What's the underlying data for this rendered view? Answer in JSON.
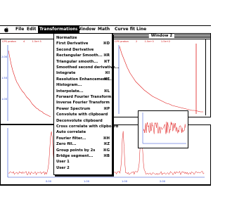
{
  "menubar": {
    "items": [
      "File",
      "Edit",
      "Transformations",
      "Window",
      "Math",
      "Curve fit",
      "Line"
    ]
  },
  "windows": {
    "left": {
      "header": [
        "CPS proton",
        "4",
        "1.5e+3"
      ]
    },
    "right": {
      "title": "Window 2",
      "header": [
        "CPS proton",
        "2",
        "1.5e+3",
        "1.5e+2"
      ]
    }
  },
  "transform_menu": {
    "items": [
      {
        "label": "Normalize",
        "key": ""
      },
      {
        "label": "First Derivative",
        "key": "⌘D"
      },
      {
        "label": "Second Derivative",
        "key": ""
      },
      {
        "label": "Rectangular Smooth...",
        "key": "⌘R"
      },
      {
        "label": "Triangular smooth...",
        "key": "⌘T"
      },
      {
        "label": "Smoothed second derivative...",
        "key": ""
      },
      {
        "label": "Integrate",
        "key": "⌘I"
      },
      {
        "label": "Resolution Enhancement...",
        "key": "⌘E"
      },
      {
        "label": "Histogram...",
        "key": ""
      },
      {
        "label": "Interpolate...",
        "key": "⌘L"
      },
      {
        "label": "Forward Fourier Transform",
        "key": ""
      },
      {
        "label": "Inverse Fourier Transform",
        "key": ""
      },
      {
        "label": "Power Spectrum",
        "key": "⌘P"
      },
      {
        "label": "Convolute with clipboard",
        "key": ""
      },
      {
        "label": "Deconvolute clipboard",
        "key": ""
      },
      {
        "label": "Cross correlate with clipboard",
        "key": ""
      },
      {
        "label": "Auto correlate",
        "key": ""
      },
      {
        "label": "Fourier filter...",
        "key": "⌘H"
      },
      {
        "label": "Zero fill...",
        "key": "⌘Z"
      },
      {
        "label": "Group points by 2s",
        "key": "⌘G"
      },
      {
        "label": "Bridge segment...",
        "key": "⌘B"
      },
      {
        "label": "User 1",
        "key": ""
      },
      {
        "label": "User 2",
        "key": ""
      }
    ]
  },
  "colors": {
    "trace": "#e01818",
    "axis": "#2040d0",
    "text": "#000000"
  }
}
